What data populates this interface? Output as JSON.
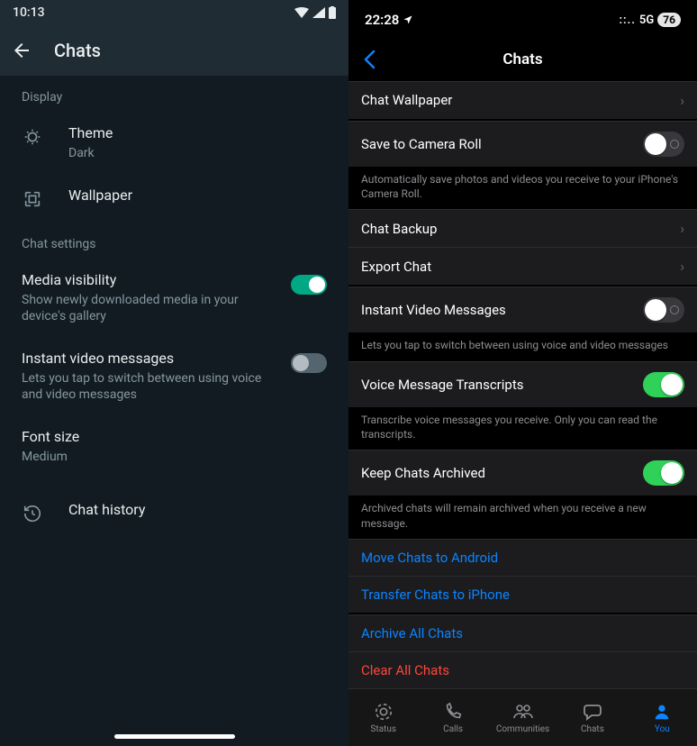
{
  "android": {
    "status": {
      "time": "10:13"
    },
    "title": "Chats",
    "sections": {
      "display": "Display",
      "chat_settings": "Chat settings"
    },
    "theme": {
      "title": "Theme",
      "value": "Dark"
    },
    "wallpaper": {
      "title": "Wallpaper"
    },
    "media_visibility": {
      "title": "Media visibility",
      "sub": "Show newly downloaded media in your device's gallery",
      "on": true
    },
    "instant_video": {
      "title": "Instant video messages",
      "sub": "Lets you tap to switch between using voice and video messages",
      "on": false
    },
    "font_size": {
      "title": "Font size",
      "value": "Medium"
    },
    "chat_history": {
      "title": "Chat history"
    }
  },
  "ios": {
    "status": {
      "time": "22:28",
      "net": "5G",
      "battery": "76"
    },
    "nav_title": "Chats",
    "chat_wallpaper": "Chat Wallpaper",
    "save_camera": {
      "title": "Save to Camera Roll",
      "on": false,
      "footer": "Automatically save photos and videos you receive to your iPhone's Camera Roll."
    },
    "chat_backup": "Chat Backup",
    "export_chat": "Export Chat",
    "instant_video": {
      "title": "Instant Video Messages",
      "on": false,
      "footer": "Lets you tap to switch between using voice and video messages"
    },
    "voice_transcripts": {
      "title": "Voice Message Transcripts",
      "on": true,
      "footer": "Transcribe voice messages you receive. Only you can read the transcripts."
    },
    "keep_archived": {
      "title": "Keep Chats Archived",
      "on": true,
      "footer": "Archived chats will remain archived when you receive a new message."
    },
    "move_android": "Move Chats to Android",
    "transfer_iphone": "Transfer Chats to iPhone",
    "archive_all": "Archive All Chats",
    "clear_all": "Clear All Chats",
    "tabs": {
      "status": "Status",
      "calls": "Calls",
      "communities": "Communities",
      "chats": "Chats",
      "you": "You"
    }
  }
}
